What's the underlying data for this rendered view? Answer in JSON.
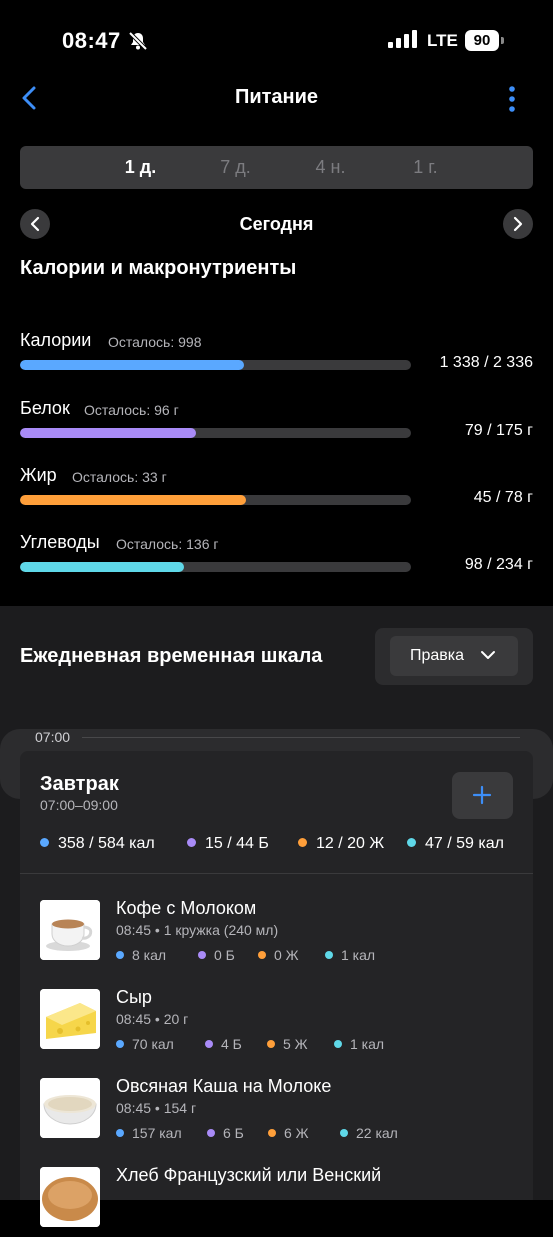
{
  "status": {
    "time": "08:47",
    "network": "LTE",
    "battery": "90"
  },
  "header": {
    "title": "Питание"
  },
  "periods": [
    "1 д.",
    "7 д.",
    "4 н.",
    "1 г."
  ],
  "active_period": 0,
  "date_label": "Сегодня",
  "summary_title": "Калории и макронутриенты",
  "nutrients": [
    {
      "name": "Калории",
      "remaining": "Осталось: 998",
      "value": "1 338 / 2 336",
      "progress": 0.573,
      "color": "#5aa8ff"
    },
    {
      "name": "Белок",
      "remaining": "Осталось: 96 г",
      "value": "79 / 175 г",
      "progress": 0.451,
      "color": "#a98bf7"
    },
    {
      "name": "Жир",
      "remaining": "Осталось: 33 г",
      "value": "45 / 78 г",
      "progress": 0.577,
      "color": "#ff9f3a"
    },
    {
      "name": "Углеводы",
      "remaining": "Осталось: 136 г",
      "value": "98 / 234 г",
      "progress": 0.419,
      "color": "#5fd8e8"
    }
  ],
  "timeline": {
    "title": "Ежедневная временная шкала",
    "edit_label": "Правка",
    "time_marker": "07:00"
  },
  "meal": {
    "title": "Завтрак",
    "time": "07:00–09:00",
    "macros": [
      "358 / 584 кал",
      "15 / 44 Б",
      "12 / 20 Ж",
      "47 / 59 кал"
    ],
    "items": [
      {
        "name": "Кофе с Молоком",
        "sub": "08:45 • 1 кружка (240 мл)",
        "image": "coffee-cup",
        "macros": [
          "8 кал",
          "0 Б",
          "0 Ж",
          "1 кал"
        ]
      },
      {
        "name": "Сыр",
        "sub": "08:45 • 20 г",
        "image": "cheese",
        "macros": [
          "70 кал",
          "4 Б",
          "5 Ж",
          "1 кал"
        ]
      },
      {
        "name": "Овсяная Каша на Молоке",
        "sub": "08:45 • 154 г",
        "image": "oatmeal-bowl",
        "macros": [
          "157 кал",
          "6 Б",
          "6 Ж",
          "22 кал"
        ]
      },
      {
        "name": "Хлеб Французский или Венский",
        "sub": "",
        "image": "bread",
        "macros": []
      }
    ]
  },
  "colors": {
    "calories": "#5aa8ff",
    "protein": "#a98bf7",
    "fat": "#ff9f3a",
    "carbs": "#5fd8e8",
    "accent": "#3d8ef7"
  }
}
